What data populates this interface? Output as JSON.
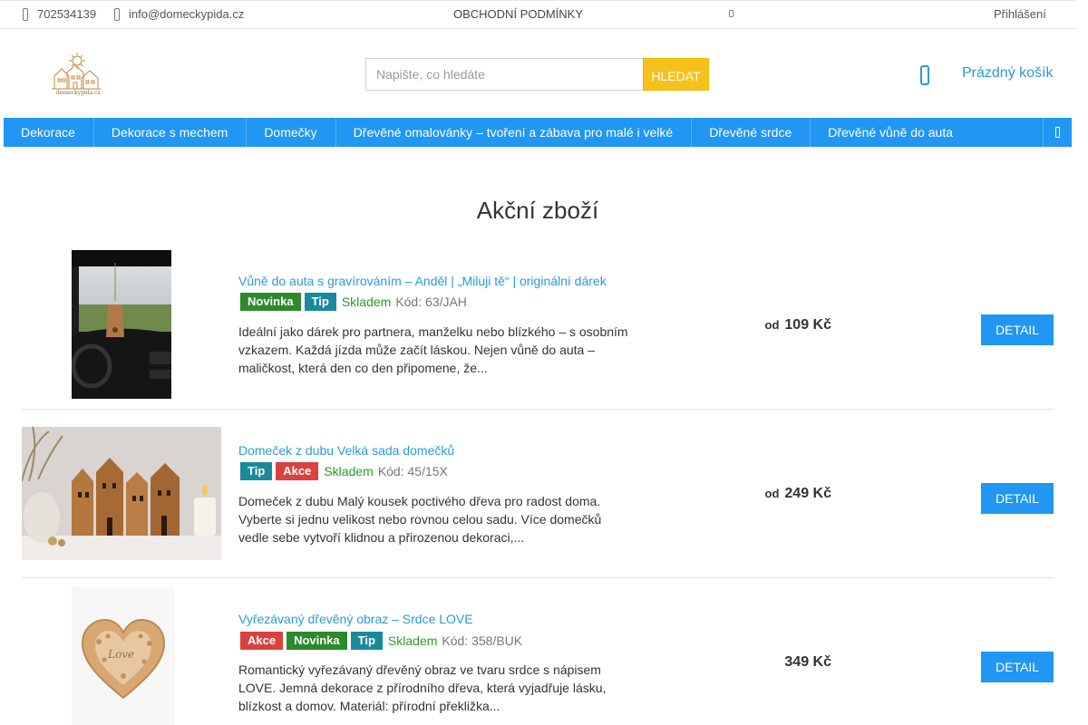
{
  "topbar": {
    "phone": "702534139",
    "email": "info@domeckypida.cz",
    "terms": "OBCHODNÍ PODMÍNKY",
    "login": "Přihlášení"
  },
  "logo": {
    "text": "domeckypida.cz"
  },
  "search": {
    "placeholder": "Napište, co hledáte",
    "button": "HLEDAT"
  },
  "cart": {
    "label": "Prázdný košík"
  },
  "nav": {
    "items": [
      "Dekorace",
      "Dekorace s mechem",
      "Domečky",
      "Dřevěné omalovánky – tvoření a zábava pro malé i velké",
      "Dřevěné srdce",
      "Dřevěné vůně do auta"
    ]
  },
  "page": {
    "title": "Akční zboží"
  },
  "products": [
    {
      "title": "Vůně do auta s gravírováním – Anděl | „Miluji tě“ | originální dárek",
      "badges": [
        "Novinka",
        "Tip"
      ],
      "stock": "Skladem",
      "code": "Kód: 63/JAH",
      "desc": " Ideální jako dárek pro partnera, manželku nebo blízkého – s osobním vzkazem.  Každá jízda může začít láskou. Nejen vůně do auta – maličkost, která den co den připomene, že...",
      "price_prefix": "od",
      "price": "109 Kč",
      "button": "DETAIL"
    },
    {
      "title": "Domeček z dubu Velká sada domečků",
      "badges": [
        "Tip",
        "Akce"
      ],
      "stock": "Skladem",
      "code": "Kód: 45/15X",
      "desc": "Domeček z dubu Malý kousek poctivého dřeva pro radost doma. Vyberte si jednu velikost nebo rovnou celou sadu. Více domečků vedle sebe vytvoří klidnou a přirozenou dekoraci,...",
      "price_prefix": "od",
      "price": "249 Kč",
      "button": "DETAIL"
    },
    {
      "title": "Vyřezávaný dřevěný obraz – Srdce LOVE",
      "badges": [
        "Akce",
        "Novinka",
        "Tip"
      ],
      "stock": "Skladem",
      "code": "Kód: 358/BUK",
      "desc": "Romantický vyřezávaný dřevěný obraz ve tvaru srdce s nápisem LOVE. Jemná dekorace z přírodního dřeva, která vyjadřuje lásku, blízkost a domov.  Materiál: přírodní překližka...",
      "price_prefix": "",
      "price": "349 Kč",
      "button": "DETAIL"
    }
  ],
  "colors": {
    "accent": "#2196f3",
    "link": "#2a9bd6",
    "search_button": "#f5c21b",
    "badge_new": "#2c8a2c",
    "badge_tip": "#1a8a9a",
    "badge_sale": "#d9423f",
    "stock": "#2a9a2a"
  },
  "icons": {
    "phone": "phone-icon",
    "email": "mail-icon",
    "cart": "cart-icon",
    "nav_more": "menu-more-icon"
  }
}
